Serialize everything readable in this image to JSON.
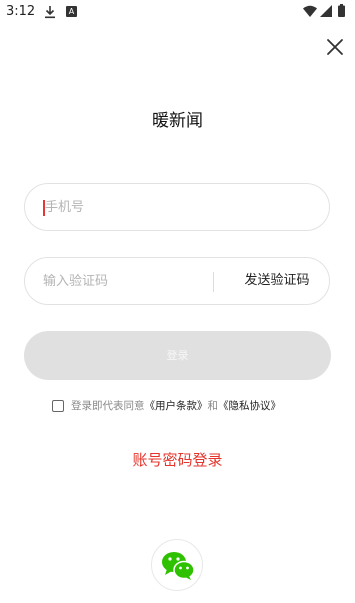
{
  "status_bar": {
    "time": "3:12",
    "notif_letter": "A"
  },
  "app": {
    "title": "暖新闻"
  },
  "phone": {
    "placeholder": "手机号"
  },
  "code": {
    "placeholder": "输入验证码",
    "send_label": "发送验证码"
  },
  "login": {
    "label": "登录"
  },
  "agreement": {
    "prefix": "登录即代表同意",
    "user_terms": "《用户条款》",
    "and": "和",
    "privacy": "《隐私协议》",
    "checked": false
  },
  "alt_login": {
    "password_label": "账号密码登录"
  },
  "colors": {
    "accent": "#e5342b",
    "wechat": "#2dc100",
    "disabled_button": "#e0e0e0"
  }
}
